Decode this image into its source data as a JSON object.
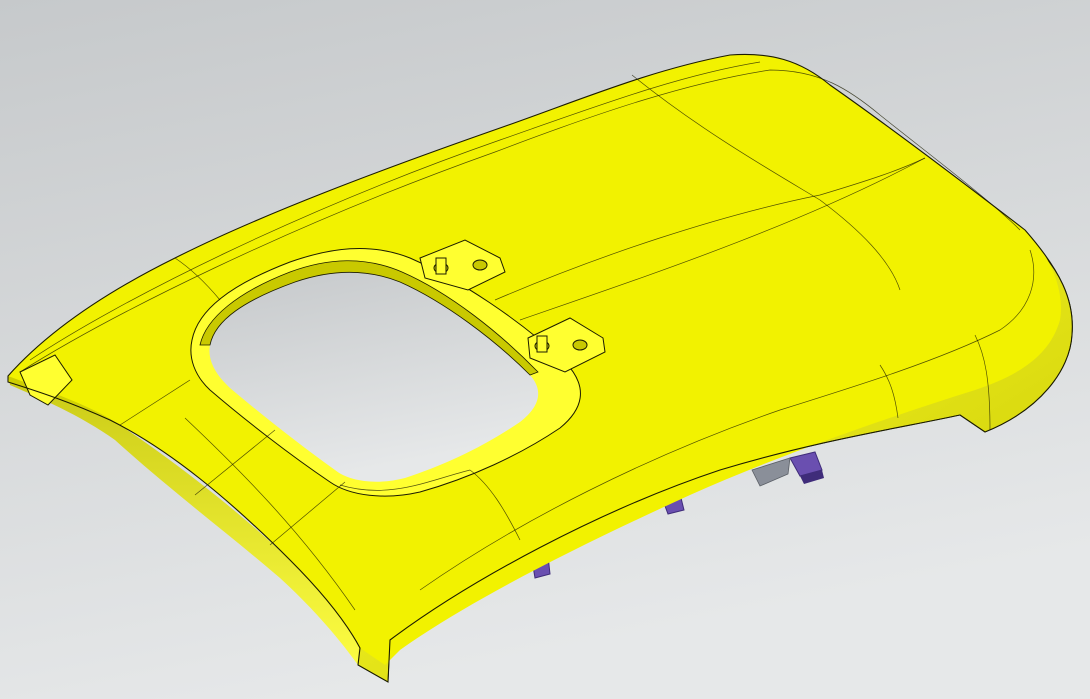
{
  "viewport": {
    "background_top": "#c6c9cb",
    "background_bottom": "#e6e8e9"
  },
  "model": {
    "part": "headliner-panel",
    "surface_color": "#f2f200",
    "surface_highlight": "#ffff30",
    "surface_shade": "#c9c900",
    "edge_color": "#1c1c00",
    "bracket_color": "#6a4fb0",
    "bracket_shade": "#3f2c7a",
    "clip_color": "#8a8f99"
  }
}
